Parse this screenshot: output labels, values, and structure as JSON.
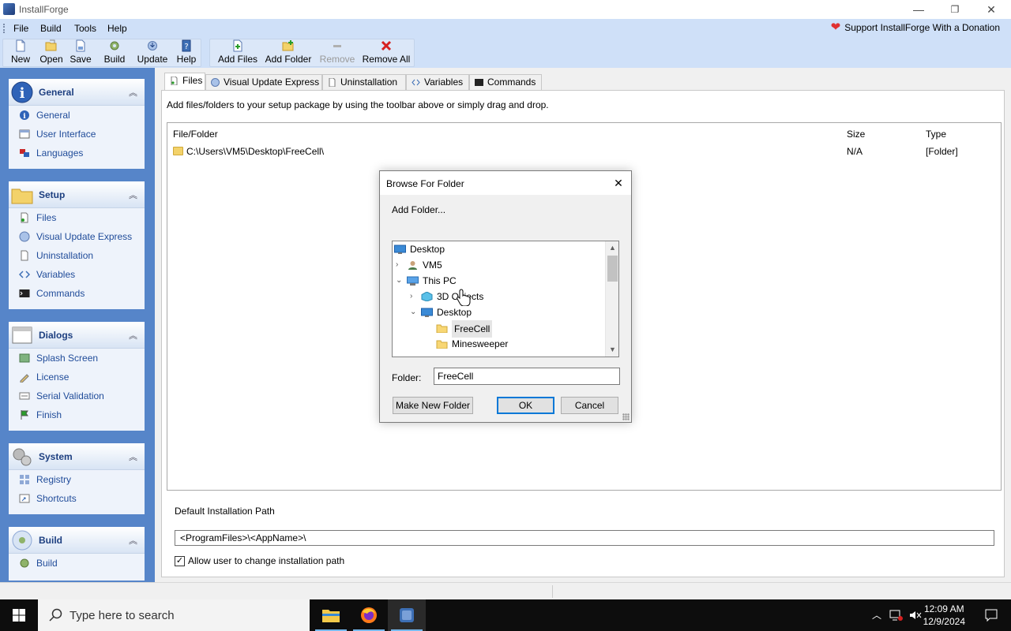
{
  "window": {
    "title": "InstallForge",
    "minimize": "—",
    "restore": "❐",
    "close": "✕"
  },
  "menubar": {
    "items": [
      "File",
      "Build",
      "Tools",
      "Help"
    ],
    "donate": "Support InstallForge With a Donation"
  },
  "toolbar": {
    "new": "New",
    "open": "Open",
    "save": "Save",
    "build": "Build",
    "update": "Update",
    "help": "Help",
    "add_files": "Add Files",
    "add_folder": "Add Folder",
    "remove": "Remove",
    "remove_all": "Remove All"
  },
  "sidebar": {
    "panels": [
      {
        "title": "General",
        "items": [
          "General",
          "User Interface",
          "Languages"
        ]
      },
      {
        "title": "Setup",
        "items": [
          "Files",
          "Visual Update Express",
          "Uninstallation",
          "Variables",
          "Commands"
        ]
      },
      {
        "title": "Dialogs",
        "items": [
          "Splash Screen",
          "License",
          "Serial Validation",
          "Finish"
        ]
      },
      {
        "title": "System",
        "items": [
          "Registry",
          "Shortcuts"
        ]
      },
      {
        "title": "Build",
        "items": [
          "Build"
        ]
      }
    ]
  },
  "tabs": [
    "Files",
    "Visual Update Express",
    "Uninstallation",
    "Variables",
    "Commands"
  ],
  "files_page": {
    "hint": "Add files/folders to your setup package by using the toolbar above or simply drag and drop.",
    "columns": {
      "file": "File/Folder",
      "size": "Size",
      "type": "Type"
    },
    "rows": [
      {
        "path": "C:\\Users\\VM5\\Desktop\\FreeCell\\",
        "size": "N/A",
        "type": "[Folder]"
      }
    ],
    "default_path_label": "Default Installation Path",
    "default_path": "<ProgramFiles>\\<AppName>\\",
    "allow_change_label": "Allow user to change installation path",
    "allow_change_checked": true
  },
  "dialog": {
    "title": "Browse For Folder",
    "prompt": "Add Folder...",
    "tree": [
      {
        "label": "Desktop",
        "level": 0,
        "expander": "",
        "icon": "desktop"
      },
      {
        "label": "VM5",
        "level": 1,
        "expander": ">",
        "icon": "user"
      },
      {
        "label": "This PC",
        "level": 1,
        "expander": "v",
        "icon": "pc"
      },
      {
        "label": "3D Objects",
        "level": 2,
        "expander": ">",
        "icon": "cube"
      },
      {
        "label": "Desktop",
        "level": 2,
        "expander": "v",
        "icon": "desktop"
      },
      {
        "label": "FreeCell",
        "level": 3,
        "expander": "",
        "icon": "folder",
        "selected": true
      },
      {
        "label": "Minesweeper",
        "level": 3,
        "expander": "",
        "icon": "folder"
      }
    ],
    "folder_label": "Folder:",
    "folder_value": "FreeCell",
    "make_new_folder": "Make New Folder",
    "ok": "OK",
    "cancel": "Cancel"
  },
  "taskbar": {
    "search_placeholder": "Type here to search",
    "time": "12:09 AM",
    "date": "12/9/2024"
  },
  "colors": {
    "accent": "#0078d7",
    "sidebar_bg": "#5685c9",
    "band_bg": "#cfe0f8",
    "link": "#1f4b99"
  }
}
